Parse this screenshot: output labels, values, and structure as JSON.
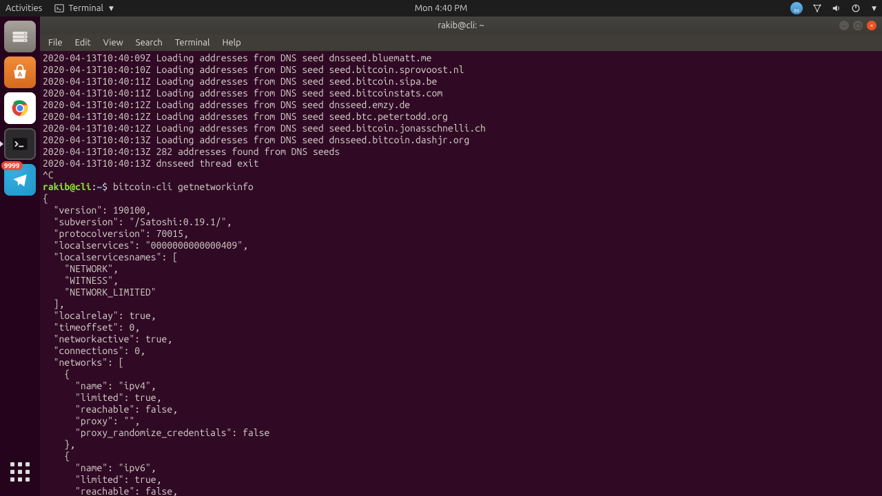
{
  "topbar": {
    "activities": "Activities",
    "app_label": "Terminal",
    "clock": "Mon  4:40 PM",
    "weather_temp": "86"
  },
  "launcher": {
    "badge": "9999"
  },
  "window": {
    "title": "rakib@cli: ~",
    "menus": [
      "File",
      "Edit",
      "View",
      "Search",
      "Terminal",
      "Help"
    ]
  },
  "prompt": {
    "userhost": "rakib@cli",
    "sep": ":",
    "path": "~",
    "dollar": "$ ",
    "command": "bitcoin-cli getnetworkinfo"
  },
  "log_lines": [
    "2020-04-13T10:40:09Z Loading addresses from DNS seed dnsseed.bluematt.me",
    "2020-04-13T10:40:10Z Loading addresses from DNS seed seed.bitcoin.sprovoost.nl",
    "2020-04-13T10:40:11Z Loading addresses from DNS seed seed.bitcoin.sipa.be",
    "2020-04-13T10:40:11Z Loading addresses from DNS seed seed.bitcoinstats.com",
    "2020-04-13T10:40:12Z Loading addresses from DNS seed dnsseed.emzy.de",
    "2020-04-13T10:40:12Z Loading addresses from DNS seed seed.btc.petertodd.org",
    "2020-04-13T10:40:12Z Loading addresses from DNS seed seed.bitcoin.jonasschnelli.ch",
    "2020-04-13T10:40:13Z Loading addresses from DNS seed dnsseed.bitcoin.dashjr.org",
    "2020-04-13T10:40:13Z 282 addresses found from DNS seeds",
    "2020-04-13T10:40:13Z dnsseed thread exit",
    "^C"
  ],
  "json_lines": [
    "{",
    "  \"version\": 190100,",
    "  \"subversion\": \"/Satoshi:0.19.1/\",",
    "  \"protocolversion\": 70015,",
    "  \"localservices\": \"0000000000000409\",",
    "  \"localservicesnames\": [",
    "    \"NETWORK\",",
    "    \"WITNESS\",",
    "    \"NETWORK_LIMITED\"",
    "  ],",
    "  \"localrelay\": true,",
    "  \"timeoffset\": 0,",
    "  \"networkactive\": true,",
    "  \"connections\": 0,",
    "  \"networks\": [",
    "    {",
    "      \"name\": \"ipv4\",",
    "      \"limited\": true,",
    "      \"reachable\": false,",
    "      \"proxy\": \"\",",
    "      \"proxy_randomize_credentials\": false",
    "    },",
    "    {",
    "      \"name\": \"ipv6\",",
    "      \"limited\": true,",
    "      \"reachable\": false,"
  ]
}
